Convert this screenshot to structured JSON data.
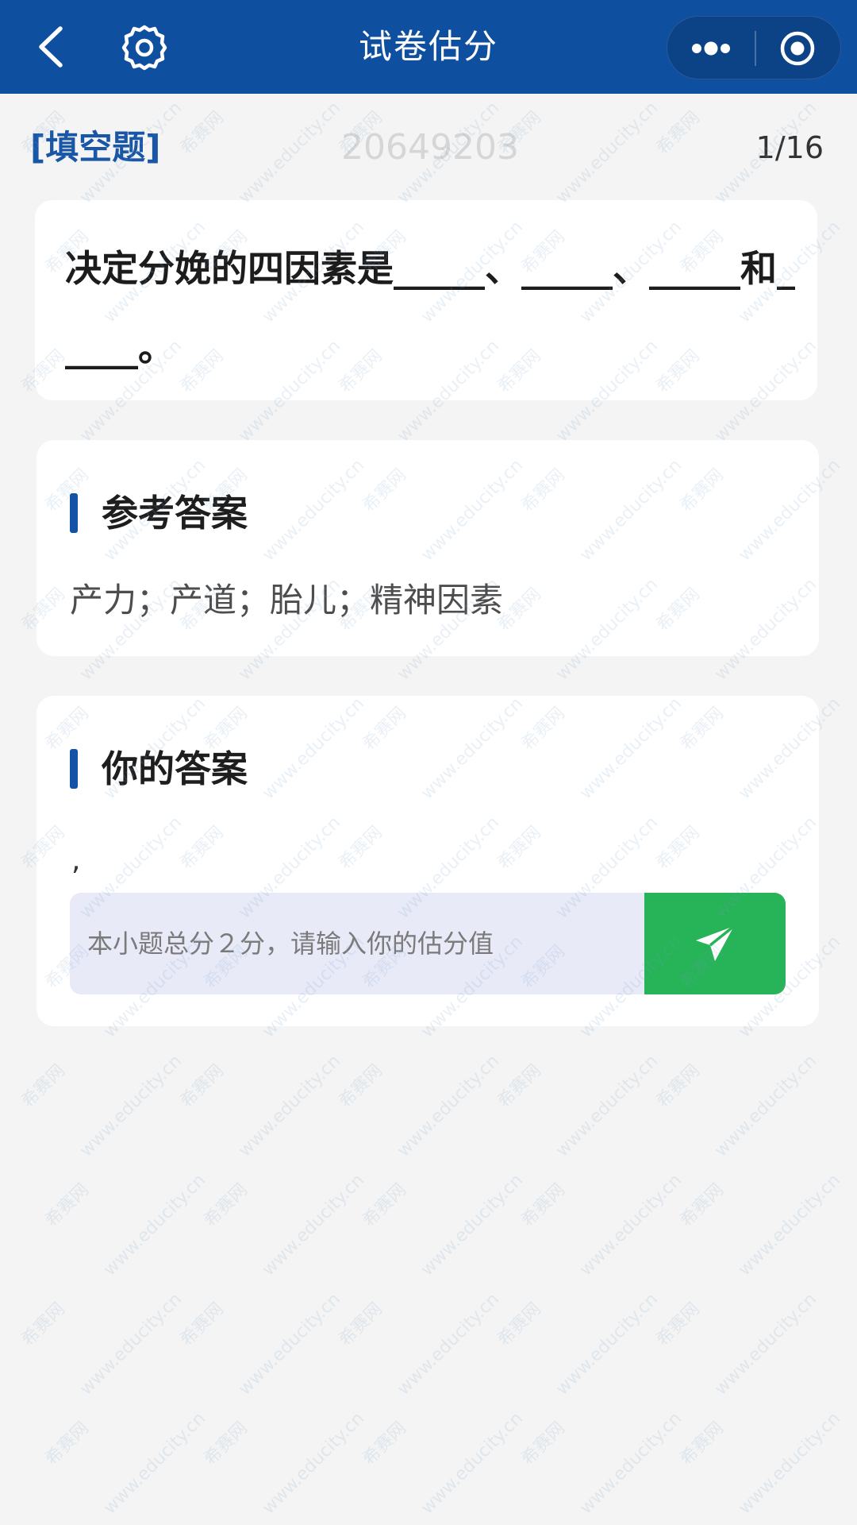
{
  "header": {
    "title": "试卷估分",
    "back_icon": "chevron-left-icon",
    "settings_icon": "gear-icon",
    "more_icon": "more-dots-icon",
    "close_icon": "target-circle-icon",
    "bg_color": "#0f4fa0"
  },
  "question": {
    "type_label": "[填空题]",
    "id_watermark": "20649203",
    "counter": "1/16",
    "text": "决定分娩的四因素是_____、_____、_____和_____。"
  },
  "reference": {
    "title": "参考答案",
    "answer": "产力；产道；胎儿；精神因素"
  },
  "mine": {
    "title": "你的答案",
    "answer": ",",
    "input_placeholder": "本小题总分２分，请输入你的估分值",
    "send_icon": "send-paper-plane-icon",
    "send_color": "#27b357"
  },
  "watermark": {
    "brand": "希赛网",
    "site": "www.educity.cn"
  }
}
